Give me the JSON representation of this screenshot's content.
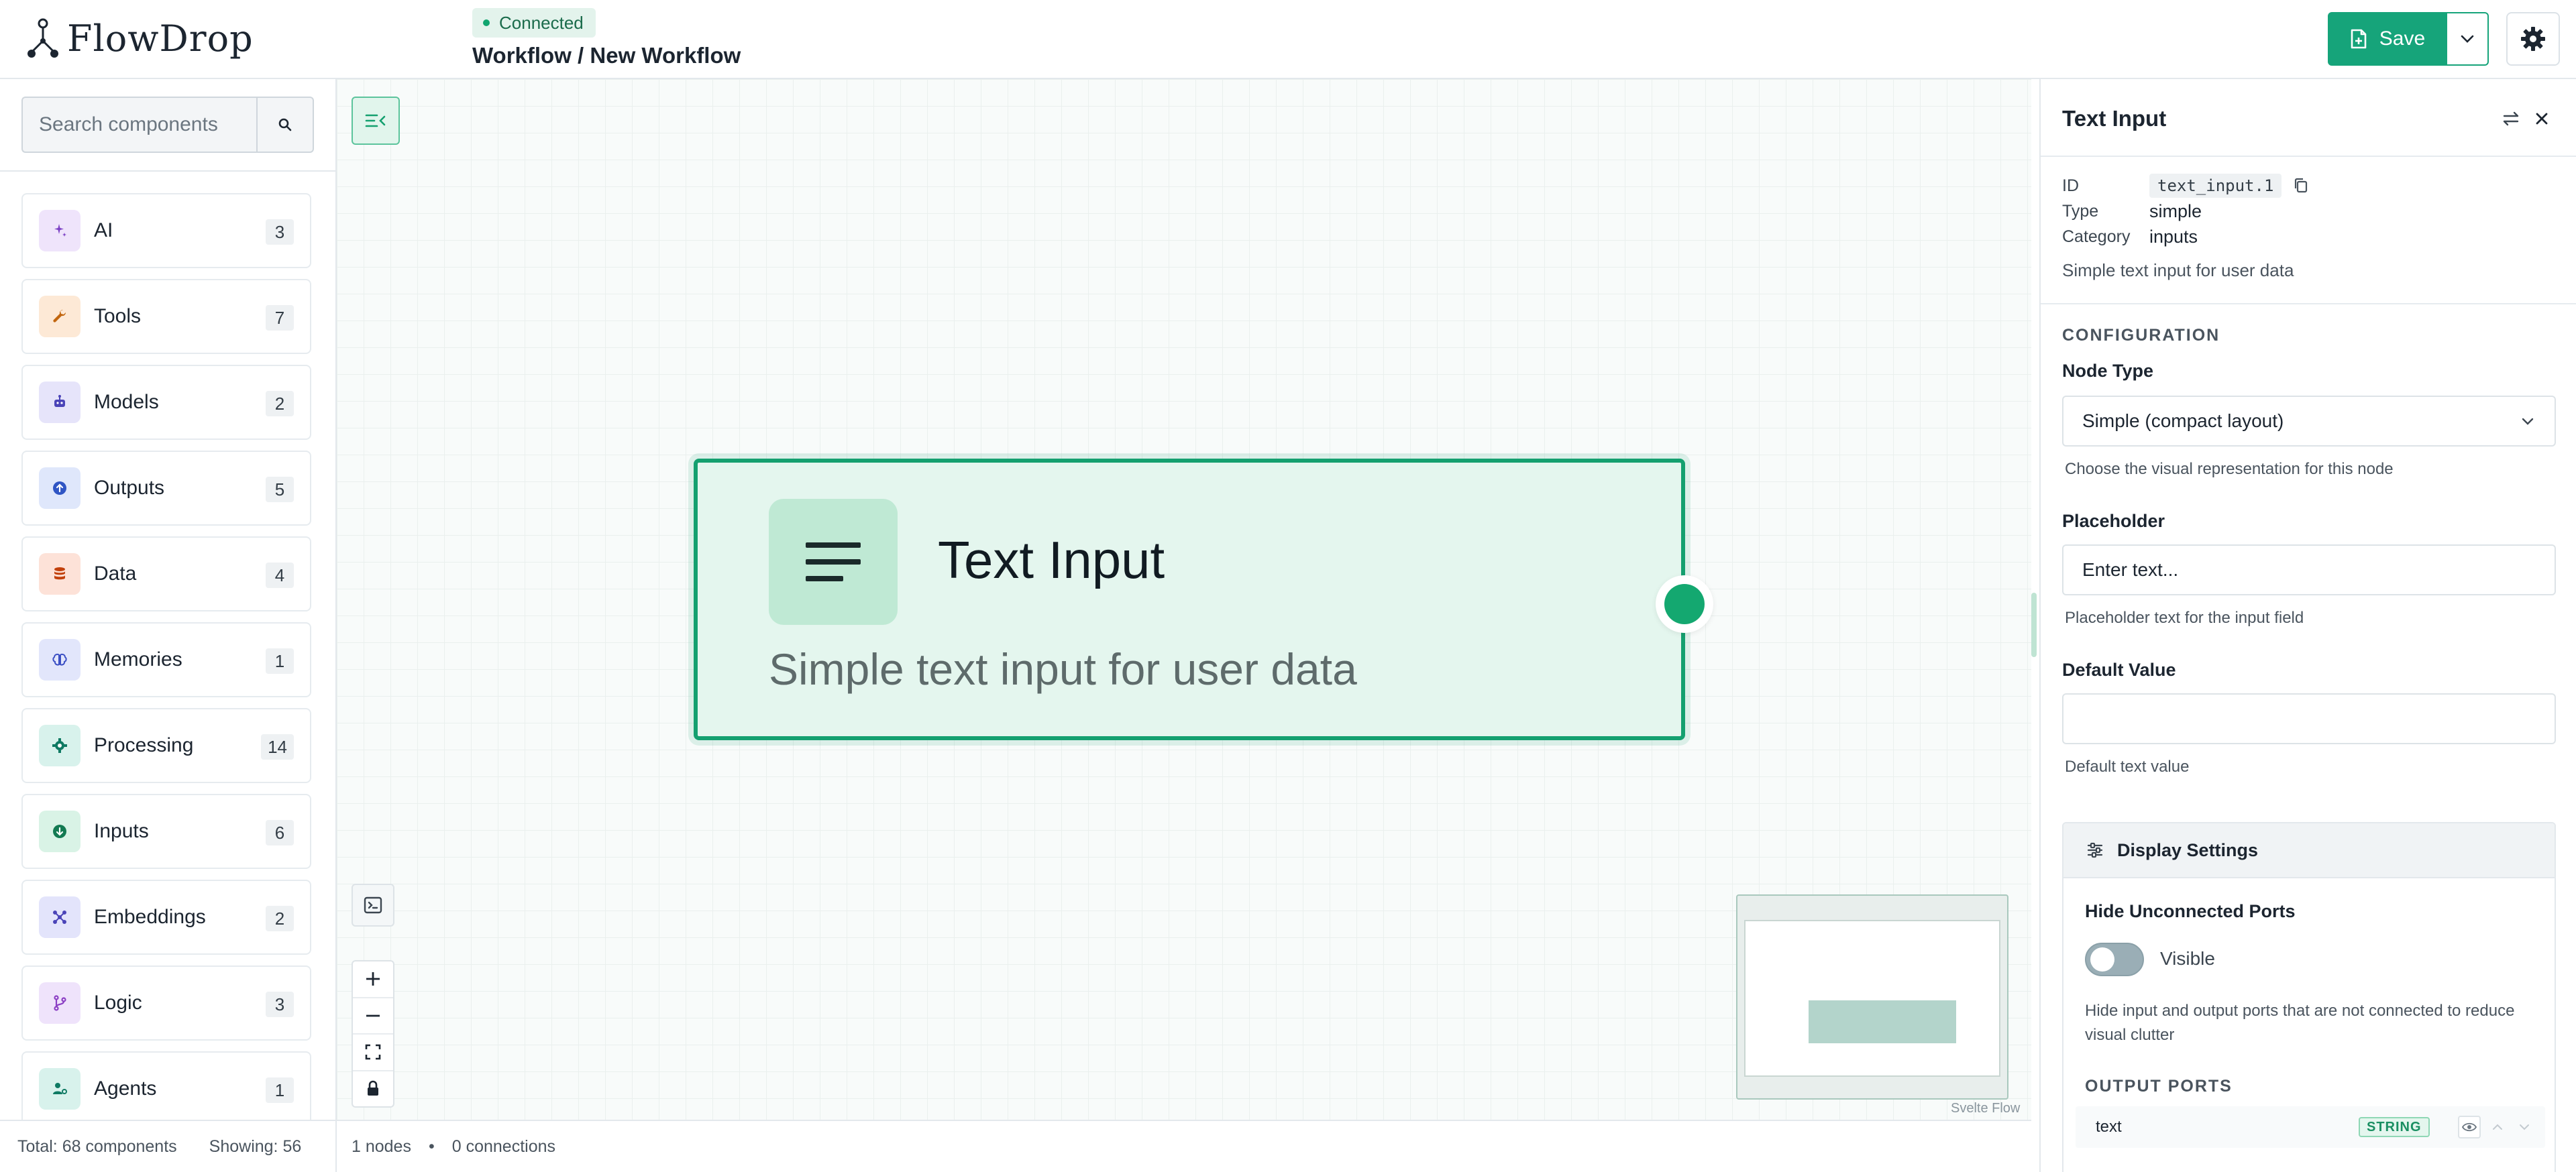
{
  "app": {
    "brand": "FlowDrop",
    "status": "Connected",
    "breadcrumb": "Workflow / New Workflow",
    "save_label": "Save"
  },
  "colors": {
    "accent": "#16a47a",
    "node_border": "#14a06f",
    "node_fill": "#e4f6ee"
  },
  "sidebar": {
    "search_placeholder": "Search components",
    "categories": [
      {
        "label": "AI",
        "count": "3",
        "icon": "sparkles-icon",
        "bg": "#efe4fb",
        "fg": "#7b3fc4"
      },
      {
        "label": "Tools",
        "count": "7",
        "icon": "wrench-icon",
        "bg": "#fde9d6",
        "fg": "#c2660f"
      },
      {
        "label": "Models",
        "count": "2",
        "icon": "robot-icon",
        "bg": "#e6e4fa",
        "fg": "#4b44b8"
      },
      {
        "label": "Outputs",
        "count": "5",
        "icon": "upload-circle-icon",
        "bg": "#dfe7fb",
        "fg": "#2f55c4"
      },
      {
        "label": "Data",
        "count": "4",
        "icon": "database-icon",
        "bg": "#fde2d8",
        "fg": "#c2410c"
      },
      {
        "label": "Memories",
        "count": "1",
        "icon": "brain-icon",
        "bg": "#e2e6fb",
        "fg": "#3b4fc4"
      },
      {
        "label": "Processing",
        "count": "14",
        "icon": "gear-icon",
        "bg": "#d8f2ec",
        "fg": "#0f7a63"
      },
      {
        "label": "Inputs",
        "count": "6",
        "icon": "download-circle-icon",
        "bg": "#d9f3e6",
        "fg": "#137a52"
      },
      {
        "label": "Embeddings",
        "count": "2",
        "icon": "network-icon",
        "bg": "#e3e4fb",
        "fg": "#4b44b8"
      },
      {
        "label": "Logic",
        "count": "3",
        "icon": "git-branch-icon",
        "bg": "#efe3fb",
        "fg": "#8b3fc4"
      },
      {
        "label": "Agents",
        "count": "1",
        "icon": "agent-icon",
        "bg": "#d8f2ec",
        "fg": "#0f7a63"
      }
    ],
    "footer": {
      "total": "Total: 68 components",
      "showing": "Showing: 56"
    }
  },
  "canvas": {
    "node": {
      "title": "Text Input",
      "description": "Simple text input for user data"
    },
    "attribution": "Svelte Flow",
    "footer": {
      "nodes": "1 nodes",
      "separator": "•",
      "connections": "0 connections"
    }
  },
  "panel": {
    "title": "Text Input",
    "meta": {
      "id_label": "ID",
      "id_value": "text_input.1",
      "type_label": "Type",
      "type_value": "simple",
      "category_label": "Category",
      "category_value": "inputs",
      "description": "Simple text input for user data"
    },
    "configuration_label": "CONFIGURATION",
    "node_type": {
      "label": "Node Type",
      "value": "Simple (compact layout)",
      "help": "Choose the visual representation for this node"
    },
    "placeholder": {
      "label": "Placeholder",
      "value": "Enter text...",
      "help": "Placeholder text for the input field"
    },
    "default_value": {
      "label": "Default Value",
      "value": "",
      "help": "Default text value"
    },
    "display_settings": {
      "title": "Display Settings",
      "hide_label": "Hide Unconnected Ports",
      "toggle_text": "Visible",
      "hide_help": "Hide input and output ports that are not connected to reduce visual clutter",
      "output_ports_label": "OUTPUT PORTS",
      "ports": [
        {
          "name": "text",
          "type": "STRING"
        }
      ]
    }
  }
}
